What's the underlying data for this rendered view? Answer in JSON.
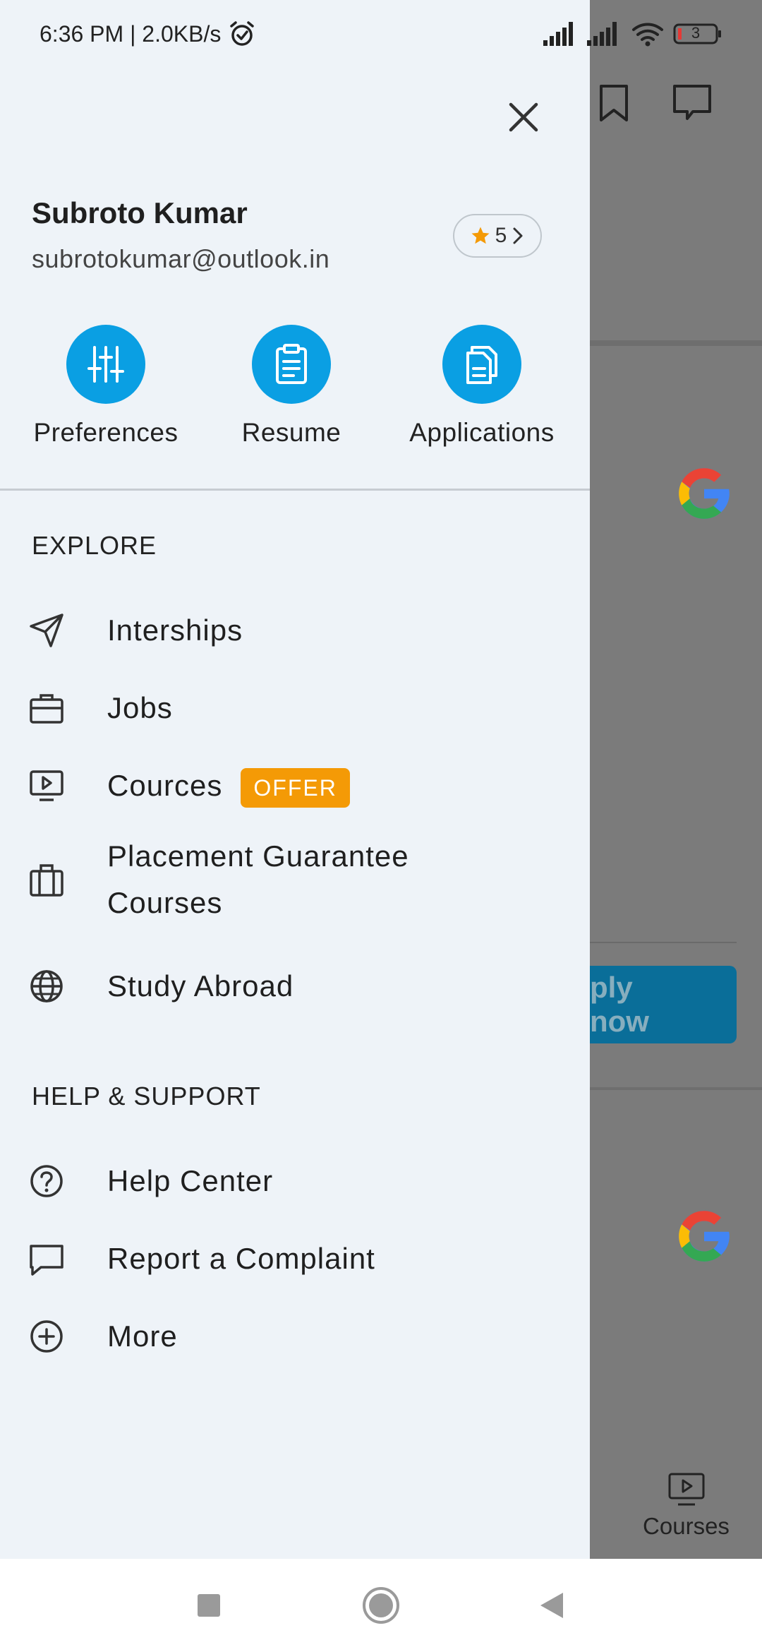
{
  "status_bar": {
    "time_speed": "6:36 PM | 2.0KB/s",
    "battery_level": "3"
  },
  "profile": {
    "name": "Subroto Kumar",
    "email": "subrotokumar@outlook.in",
    "rating": "5"
  },
  "quick_actions": [
    {
      "label": "Preferences",
      "icon": "sliders-icon"
    },
    {
      "label": "Resume",
      "icon": "clipboard-icon"
    },
    {
      "label": "Applications",
      "icon": "documents-icon"
    }
  ],
  "explore": {
    "title": "EXPLORE",
    "items": [
      {
        "label": "Interships",
        "icon": "send-icon"
      },
      {
        "label": "Jobs",
        "icon": "briefcase-icon"
      },
      {
        "label": "Cources",
        "icon": "play-screen-icon",
        "badge": "OFFER"
      },
      {
        "label_line1": "Placement Guarantee",
        "label_line2": "Courses",
        "icon": "suitcase-icon"
      },
      {
        "label": "Study Abroad",
        "icon": "globe-icon"
      }
    ]
  },
  "help_support": {
    "title": "HELP & SUPPORT",
    "items": [
      {
        "label": "Help Center",
        "icon": "question-circle-icon"
      },
      {
        "label": "Report a Complaint",
        "icon": "chat-bubble-icon"
      },
      {
        "label": "More",
        "icon": "plus-circle-icon"
      }
    ]
  },
  "background_app": {
    "apply_button": "ply now",
    "bottom_tab_courses": "Courses"
  },
  "colors": {
    "accent": "#0a9fe3",
    "offer": "#f49a06",
    "drawer_bg": "#eef3f8",
    "scrim": "#7b7b7b"
  }
}
